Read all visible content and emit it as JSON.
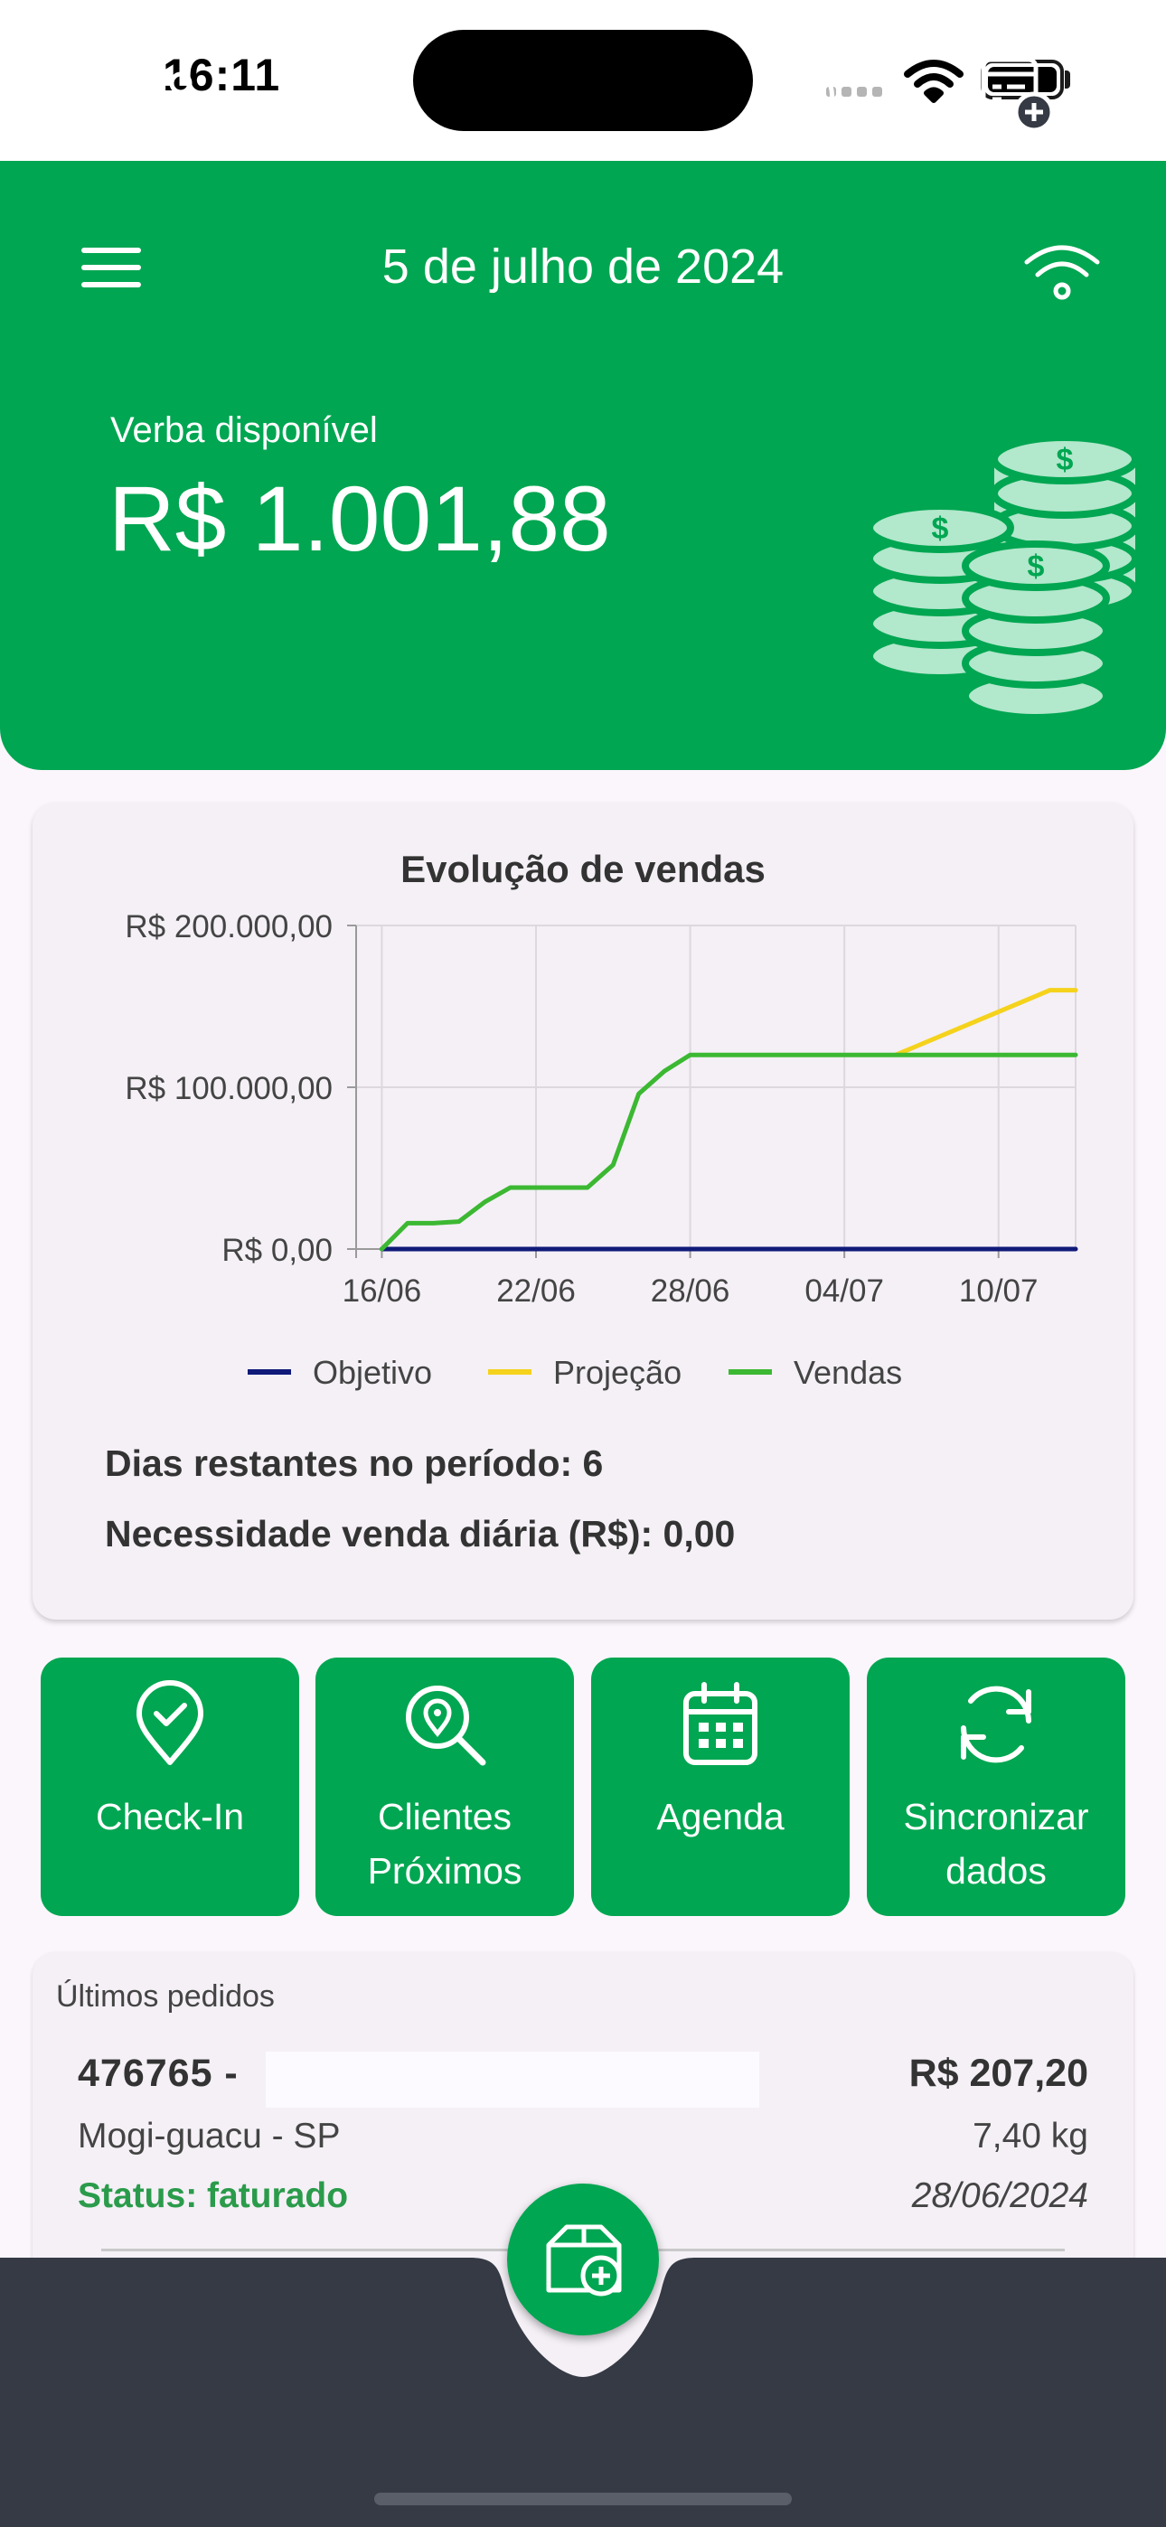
{
  "status_bar": {
    "time": "16:11"
  },
  "header": {
    "date": "5 de julho de 2024",
    "verba_label": "Verba disponível",
    "verba_value": "R$ 1.001,88"
  },
  "chart_card": {
    "footer": {
      "dias_restantes": "Dias restantes no período: 6",
      "necessidade": "Necessidade venda diária (R$): 0,00"
    }
  },
  "chart_data": {
    "type": "line",
    "title": "Evolução de vendas",
    "x_ticks": [
      "16/06",
      "22/06",
      "28/06",
      "04/07",
      "10/07"
    ],
    "y_ticks": [
      "R$ 0,00",
      "R$ 100.000,00",
      "R$ 200.000,00"
    ],
    "ylim": [
      0,
      200000
    ],
    "xlim": [
      "15/06",
      "13/07"
    ],
    "grid": true,
    "legend_position": "bottom",
    "series": [
      {
        "name": "Objetivo",
        "color": "#101a78",
        "x": [
          "16/06",
          "13/07"
        ],
        "y": [
          0,
          0
        ]
      },
      {
        "name": "Projeção",
        "color": "#f5d21c",
        "x": [
          "06/07",
          "12/07",
          "13/07"
        ],
        "y": [
          120000,
          160000,
          160000
        ]
      },
      {
        "name": "Vendas",
        "color": "#3cb832",
        "x": [
          "16/06",
          "17/06",
          "18/06",
          "19/06",
          "20/06",
          "21/06",
          "22/06",
          "23/06",
          "24/06",
          "25/06",
          "26/06",
          "27/06",
          "28/06",
          "29/06",
          "30/06",
          "01/07",
          "02/07",
          "03/07",
          "04/07",
          "05/07",
          "06/07",
          "07/07",
          "08/07",
          "09/07",
          "10/07",
          "11/07",
          "12/07",
          "13/07"
        ],
        "y": [
          0,
          16000,
          16000,
          17000,
          29000,
          38000,
          38000,
          38000,
          38000,
          52000,
          96000,
          110000,
          120000,
          120000,
          120000,
          120000,
          120000,
          120000,
          120000,
          120000,
          120000,
          120000,
          120000,
          120000,
          120000,
          120000,
          120000,
          120000
        ]
      }
    ]
  },
  "actions": [
    {
      "label": "Check-In",
      "icon": "map-pin-check-icon"
    },
    {
      "label": "Clientes\nPróximos",
      "icon": "location-search-icon"
    },
    {
      "label": "Agenda",
      "icon": "calendar-icon"
    },
    {
      "label": "Sincronizar\ndados",
      "icon": "sync-icon"
    }
  ],
  "orders": {
    "title": "Últimos pedidos",
    "items": [
      {
        "number": "476765 -",
        "value": "R$ 207,20",
        "city": "Mogi-guacu - SP",
        "weight": "7,40 kg",
        "status": "Status: faturado",
        "date": "28/06/2024"
      }
    ]
  },
  "colors": {
    "brand_green": "#00a651",
    "bottom_nav": "#353a45",
    "status_green": "#2a9b4a"
  }
}
